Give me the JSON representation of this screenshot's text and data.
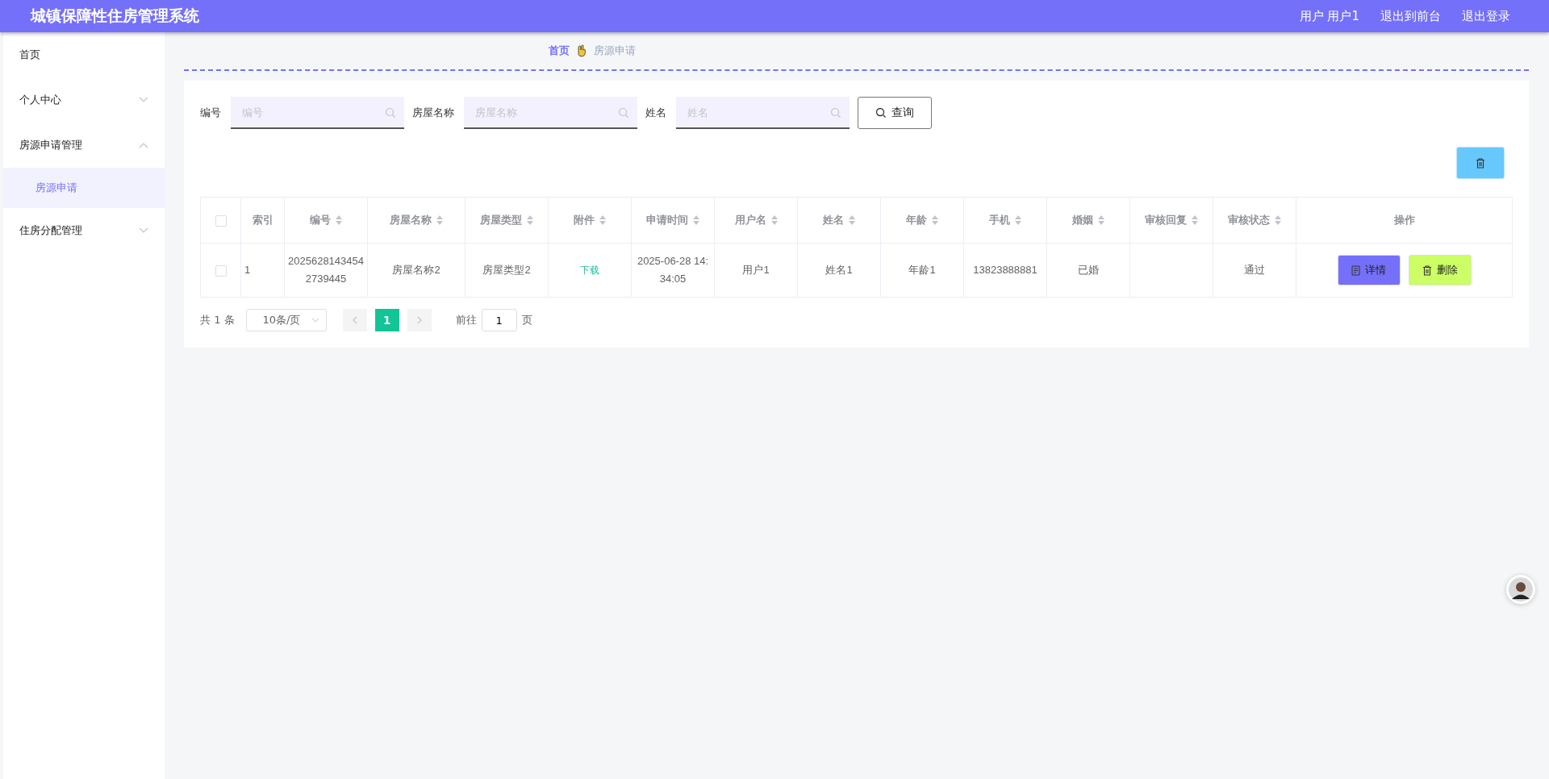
{
  "header": {
    "title": "城镇保障性住房管理系统",
    "links": [
      "用户 用户1",
      "退出到前台",
      "退出登录"
    ]
  },
  "sidebar": {
    "items": [
      {
        "label": "首页",
        "expandable": false,
        "expanded": false,
        "selected": false
      },
      {
        "label": "个人中心",
        "expandable": true,
        "expanded": false,
        "selected": false
      },
      {
        "label": "房源申请管理",
        "expandable": true,
        "expanded": true,
        "selected": false,
        "children": [
          {
            "label": "房源申请",
            "selected": true
          }
        ]
      },
      {
        "label": "住房分配管理",
        "expandable": true,
        "expanded": false,
        "selected": false
      }
    ]
  },
  "breadcrumb": [
    "首页",
    "房源申请"
  ],
  "search": {
    "fields": [
      {
        "label": "编号",
        "placeholder": "编号"
      },
      {
        "label": "房屋名称",
        "placeholder": "房屋名称"
      },
      {
        "label": "姓名",
        "placeholder": "姓名"
      }
    ],
    "button": "查询"
  },
  "table": {
    "all_checked": false,
    "columns": [
      {
        "label": "索引",
        "sortable": false
      },
      {
        "label": "编号",
        "sortable": true
      },
      {
        "label": "房屋名称",
        "sortable": true
      },
      {
        "label": "房屋类型",
        "sortable": true
      },
      {
        "label": "附件",
        "sortable": true
      },
      {
        "label": "申请时间",
        "sortable": true
      },
      {
        "label": "用户名",
        "sortable": true
      },
      {
        "label": "姓名",
        "sortable": true
      },
      {
        "label": "年龄",
        "sortable": true
      },
      {
        "label": "手机",
        "sortable": true
      },
      {
        "label": "婚姻",
        "sortable": true
      },
      {
        "label": "审核回复",
        "sortable": true
      },
      {
        "label": "审核状态",
        "sortable": true
      },
      {
        "label": "操作",
        "sortable": false
      }
    ],
    "rows": [
      {
        "checked": false,
        "cells": [
          "1",
          "20256281434542739445",
          "房屋名称2",
          "房屋类型2",
          "下载",
          "2025-06-28 14:34:05",
          "用户1",
          "姓名1",
          "年龄1",
          "13823888881",
          "已婚",
          "",
          "通过"
        ],
        "actions": [
          {
            "kind": "detail",
            "label": "详情"
          },
          {
            "kind": "delete",
            "label": "删除"
          }
        ]
      }
    ]
  },
  "pagination": {
    "total": "共 1 条",
    "page_size": "10条/页",
    "pages": [
      {
        "label": "1",
        "selected": true
      }
    ],
    "goto_label": "前往",
    "goto_value": "1",
    "goto_suffix": "页"
  }
}
